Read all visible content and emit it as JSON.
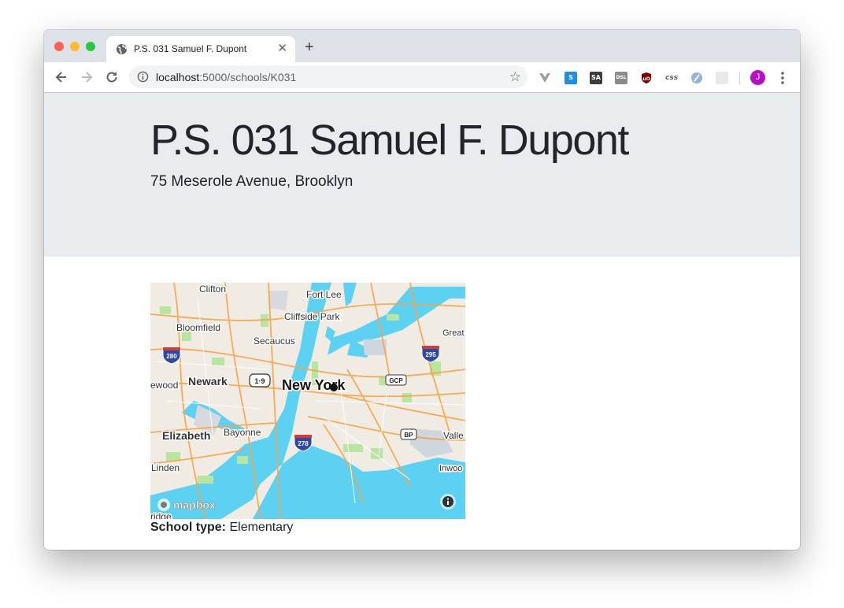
{
  "browser": {
    "tab_title": "P.S. 031 Samuel F. Dupont",
    "url_host": "localhost",
    "url_path": ":5000/schools/K031",
    "avatar_letter": "J",
    "extensions": [
      "vue-devtools-icon",
      "stylish-icon",
      "sa-icon",
      "dsl-icon",
      "ublock-icon",
      "css-icon",
      "pinboard-icon",
      "extension-icon"
    ]
  },
  "page": {
    "school_name": "P.S. 031 Samuel F. Dupont",
    "address": "75 Meserole Avenue, Brooklyn",
    "school_type_label": "School type:",
    "school_type_value": "Elementary"
  },
  "map": {
    "labels": {
      "clifton": "Clifton",
      "fort_lee": "Fort Lee",
      "bloomfield": "Bloomfield",
      "cliffside_park": "Cliffside Park",
      "secaucus": "Secaucus",
      "great": "Great",
      "newark": "Newark",
      "new_york": "New York",
      "ewood": "ewood",
      "elizabeth": "Elizabeth",
      "bayonne": "Bayonne",
      "valle": "Valle",
      "linden": "Linden",
      "inwood": "Inwoo",
      "ridge": "ridge"
    },
    "shields": {
      "i280": "280",
      "i295": "295",
      "us19": "1·9",
      "gcp": "GCP",
      "bp": "BP",
      "i278": "278"
    },
    "attribution_logo": "mapbox",
    "water_color": "#5cd1f2",
    "land_color": "#f0ece4",
    "park_color": "#b8e6a0",
    "road_color": "#f7a347"
  }
}
